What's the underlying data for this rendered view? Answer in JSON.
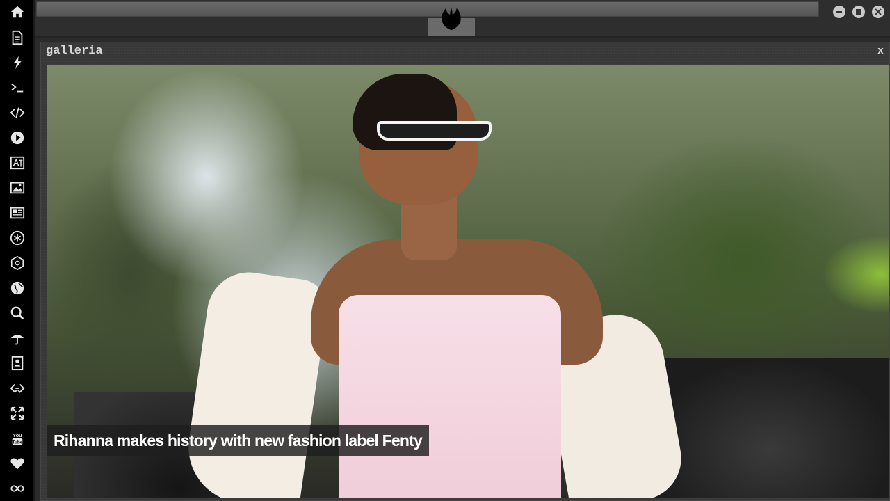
{
  "sidebar": {
    "icons": [
      {
        "name": "home-icon"
      },
      {
        "name": "document-icon"
      },
      {
        "name": "lightning-icon"
      },
      {
        "name": "terminal-icon"
      },
      {
        "name": "code-icon"
      },
      {
        "name": "play-icon"
      },
      {
        "name": "translate-icon"
      },
      {
        "name": "image-icon"
      },
      {
        "name": "newspaper-icon"
      },
      {
        "name": "rebel-icon"
      },
      {
        "name": "empire-icon"
      },
      {
        "name": "globe-icon"
      },
      {
        "name": "search-icon"
      },
      {
        "name": "umbrella-icon"
      },
      {
        "name": "contact-icon"
      },
      {
        "name": "chain-link-icon"
      },
      {
        "name": "expand-icon"
      },
      {
        "name": "youtube-icon"
      },
      {
        "name": "heart-icon"
      },
      {
        "name": "infinity-icon"
      }
    ]
  },
  "topbar": {
    "logo": "rebel-alliance-logo",
    "window_controls": [
      "minimize-icon",
      "maximize-icon",
      "close-icon"
    ]
  },
  "panel": {
    "title": "galleria",
    "close_label": "x"
  },
  "gallery": {
    "caption": "Rihanna makes history with new fashion label Fenty"
  }
}
